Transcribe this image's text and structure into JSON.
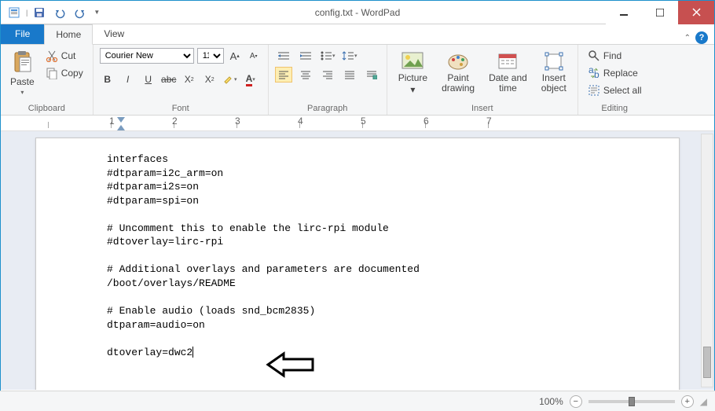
{
  "title": "config.txt - WordPad",
  "qat": {
    "save": "save",
    "undo": "undo",
    "redo": "redo"
  },
  "tabs": {
    "file": "File",
    "home": "Home",
    "view": "View"
  },
  "clipboard": {
    "paste": "Paste",
    "cut": "Cut",
    "copy": "Copy",
    "group": "Clipboard"
  },
  "font": {
    "name": "Courier New",
    "size": "11",
    "group": "Font"
  },
  "paragraph": {
    "group": "Paragraph"
  },
  "insert": {
    "picture": "Picture",
    "paint": "Paint\ndrawing",
    "datetime": "Date and\ntime",
    "object": "Insert\nobject",
    "group": "Insert"
  },
  "editing": {
    "find": "Find",
    "replace": "Replace",
    "selectall": "Select all",
    "group": "Editing"
  },
  "ruler_numbers": [
    "",
    "1",
    "2",
    "3",
    "4",
    "5",
    "6",
    "7"
  ],
  "document_lines": [
    "interfaces",
    "#dtparam=i2c_arm=on",
    "#dtparam=i2s=on",
    "#dtparam=spi=on",
    "",
    "# Uncomment this to enable the lirc-rpi module",
    "#dtoverlay=lirc-rpi",
    "",
    "# Additional overlays and parameters are documented",
    "/boot/overlays/README",
    "",
    "# Enable audio (loads snd_bcm2835)",
    "dtparam=audio=on",
    "",
    "dtoverlay=dwc2"
  ],
  "status": {
    "zoom": "100%"
  }
}
